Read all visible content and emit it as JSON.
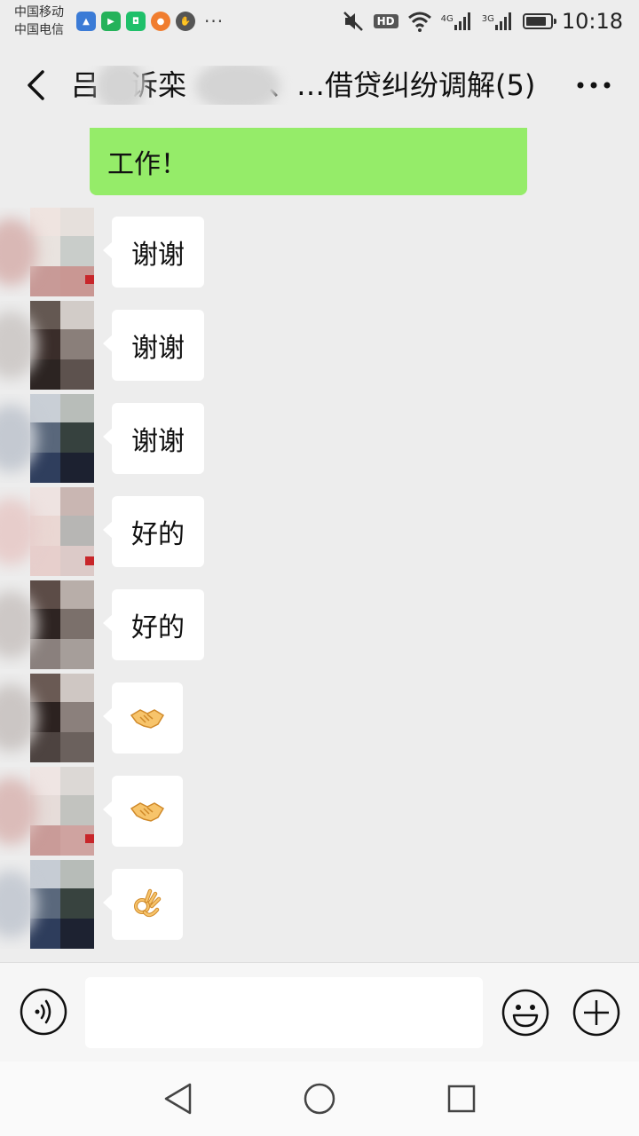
{
  "status_bar": {
    "carrier_1": "中国移动",
    "carrier_2": "中国电信",
    "hd_label": "HD",
    "net_1": "4G",
    "net_2": "3G",
    "more_dots": "···",
    "time": "10:18",
    "battery_level": 0.85,
    "icons": [
      "mute-icon",
      "wifi-icon",
      "signal-icon",
      "battery-icon"
    ]
  },
  "header": {
    "title_part_1": "吕",
    "title_part_2": "诉栾",
    "title_part_3": "、…借贷纠纷调解(5)",
    "back_icon": "chevron-left-icon",
    "more_icon": "more-dots-icon"
  },
  "chat": {
    "partial_bubble_text": "工作！",
    "messages": [
      {
        "type": "text",
        "content": "谢谢"
      },
      {
        "type": "text",
        "content": "谢谢"
      },
      {
        "type": "text",
        "content": "谢谢"
      },
      {
        "type": "text",
        "content": "好的"
      },
      {
        "type": "text",
        "content": "好的"
      },
      {
        "type": "emoji",
        "content": "handshake-emoji"
      },
      {
        "type": "emoji",
        "content": "handshake-emoji"
      },
      {
        "type": "emoji",
        "content": "ok-hand-emoji"
      }
    ]
  },
  "input_bar": {
    "value": "",
    "placeholder": "",
    "voice_icon": "voice-icon",
    "emoji_icon": "emoji-face-icon",
    "plus_icon": "plus-circle-icon"
  },
  "nav_bar": {
    "icons": [
      "nav-back-icon",
      "nav-home-icon",
      "nav-recents-icon"
    ]
  },
  "colors": {
    "chat_bg": "#ededed",
    "self_bubble": "#95ec69",
    "other_bubble": "#ffffff"
  }
}
